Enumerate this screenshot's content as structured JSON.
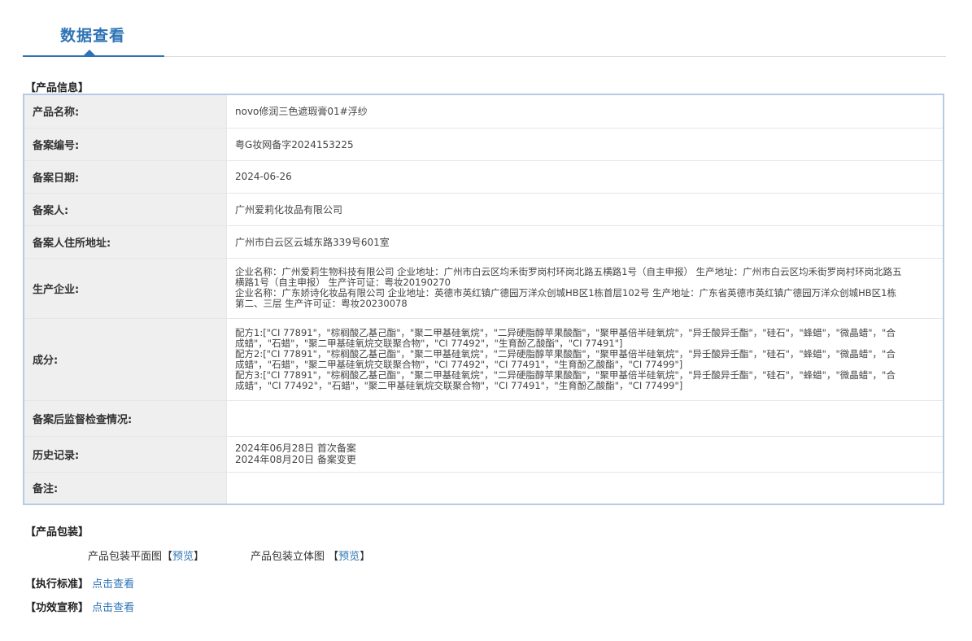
{
  "tab": {
    "title": "数据查看"
  },
  "product_info": {
    "section_title": "【产品信息】",
    "rows": {
      "name": {
        "label": "产品名称:",
        "value": "novo修润三色遮瑕膏01#浮纱"
      },
      "record_no": {
        "label": "备案编号:",
        "value": "粤G妆网备字2024153225"
      },
      "record_date": {
        "label": "备案日期:",
        "value": "2024-06-26"
      },
      "registrant": {
        "label": "备案人:",
        "value": "广州爱莉化妆品有限公司"
      },
      "registrant_address": {
        "label": "备案人住所地址:",
        "value": "广州市白云区云城东路339号601室"
      },
      "manufacturer": {
        "label": "生产企业:",
        "lines": [
          "企业名称：广州爱莉生物科技有限公司 企业地址：广州市白云区均禾街罗岗村环岗北路五横路1号（自主申报） 生产地址：广州市白云区均禾街罗岗村环岗北路五横路1号（自主申报） 生产许可证：粤妆20190270",
          "企业名称：广东娇诗化妆品有限公司 企业地址：英德市英红镇广德园万洋众创城HB区1栋首层102号 生产地址：广东省英德市英红镇广德园万洋众创城HB区1栋第二、三层 生产许可证：粤妆20230078"
        ]
      },
      "ingredients": {
        "label": "成分:",
        "lines": [
          "配方1:[\"CI 77891\"，\"棕榈酸乙基己酯\"，\"聚二甲基硅氧烷\"，\"二异硬脂醇苹果酸酯\"，\"聚甲基倍半硅氧烷\"，\"异壬酸异壬酯\"，\"硅石\"，\"蜂蜡\"，\"微晶蜡\"，\"合成蜡\"，\"石蜡\"，\"聚二甲基硅氧烷交联聚合物\"，\"CI 77492\"，\"生育酚乙酸酯\"，\"CI 77491\"]",
          "配方2:[\"CI 77891\"，\"棕榈酸乙基己酯\"，\"聚二甲基硅氧烷\"，\"二异硬脂醇苹果酸酯\"，\"聚甲基倍半硅氧烷\"，\"异壬酸异壬酯\"，\"硅石\"，\"蜂蜡\"，\"微晶蜡\"，\"合成蜡\"，\"石蜡\"，\"聚二甲基硅氧烷交联聚合物\"，\"CI 77492\"，\"CI 77491\"，\"生育酚乙酸酯\"，\"CI 77499\"]",
          "配方3:[\"CI 77891\"，\"棕榈酸乙基己酯\"，\"聚二甲基硅氧烷\"，\"二异硬脂醇苹果酸酯\"，\"聚甲基倍半硅氧烷\"，\"异壬酸异壬酯\"，\"硅石\"，\"蜂蜡\"，\"微晶蜡\"，\"合成蜡\"，\"CI 77492\"，\"石蜡\"，\"聚二甲基硅氧烷交联聚合物\"，\"CI 77491\"，\"生育酚乙酸酯\"，\"CI 77499\"]"
        ]
      },
      "inspection": {
        "label": "备案后监督检查情况:",
        "value": ""
      },
      "history": {
        "label": "历史记录:",
        "lines": [
          "2024年06月28日 首次备案",
          "2024年08月20日 备案变更"
        ]
      },
      "remarks": {
        "label": "备注:",
        "value": ""
      }
    }
  },
  "packaging": {
    "section_title": "【产品包装】",
    "flat_label": "产品包装平面图",
    "flat_link": "预览",
    "three_d_label": "产品包装立体图",
    "three_d_link": "预览",
    "open_bracket": "【",
    "close_bracket": "】"
  },
  "standard": {
    "title": "【执行标准】",
    "link": "点击查看"
  },
  "efficacy": {
    "title": "【功效宣称】",
    "link": "点击查看"
  }
}
